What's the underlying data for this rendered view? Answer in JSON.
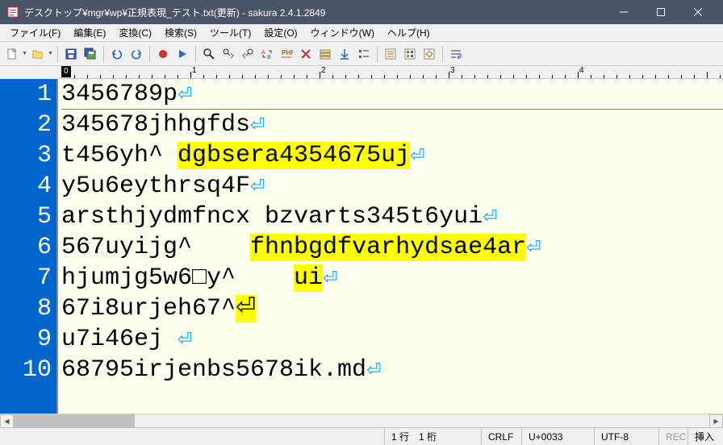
{
  "window": {
    "title": "デスクトップ¥mgr¥wp¥正規表現_テスト.txt(更新) - sakura 2.4.1.2849"
  },
  "menu": {
    "file": "ファイル(F)",
    "edit": "編集(E)",
    "convert": "変換(C)",
    "search": "検索(S)",
    "tool": "ツール(T)",
    "setting": "設定(O)",
    "window": "ウィンドウ(W)",
    "help": "ヘルプ(H)"
  },
  "ruler": {
    "pos": "0",
    "ticks": [
      "1",
      "2",
      "3",
      "4"
    ]
  },
  "lines": [
    {
      "n": "1",
      "seg": [
        [
          "3456789p",
          false
        ]
      ]
    },
    {
      "n": "2",
      "seg": [
        [
          "345678jhhgfds",
          false
        ]
      ]
    },
    {
      "n": "3",
      "seg": [
        [
          "t456yh^ ",
          false
        ],
        [
          "dgbsera4354675uj",
          true
        ]
      ]
    },
    {
      "n": "4",
      "seg": [
        [
          "y5u6eythrsq4F",
          false
        ]
      ]
    },
    {
      "n": "5",
      "seg": [
        [
          "arsthjydmfncx bzvarts345t6yui",
          false
        ]
      ]
    },
    {
      "n": "6",
      "seg": [
        [
          "567uyijg^    ",
          false
        ],
        [
          "fhnbgdfvarhydsae4ar",
          true
        ]
      ]
    },
    {
      "n": "7",
      "seg": [
        [
          "hjumjg5w6□y^    ",
          false
        ],
        [
          "ui",
          true
        ]
      ]
    },
    {
      "n": "8",
      "seg": [
        [
          "67i8urjeh67^",
          false
        ],
        [
          "⏎",
          true
        ]
      ],
      "eol_in_hl": true
    },
    {
      "n": "9",
      "seg": [
        [
          "u7i46ej ",
          false
        ]
      ]
    },
    {
      "n": "10",
      "seg": [
        [
          "68795irjenbs5678ik.md",
          false
        ]
      ]
    }
  ],
  "status": {
    "row_col": "1 行　1 桁",
    "lineend": "CRLF",
    "codepoint": "U+0033",
    "encoding": "UTF-8",
    "rec": "REC",
    "ins": "挿入"
  }
}
